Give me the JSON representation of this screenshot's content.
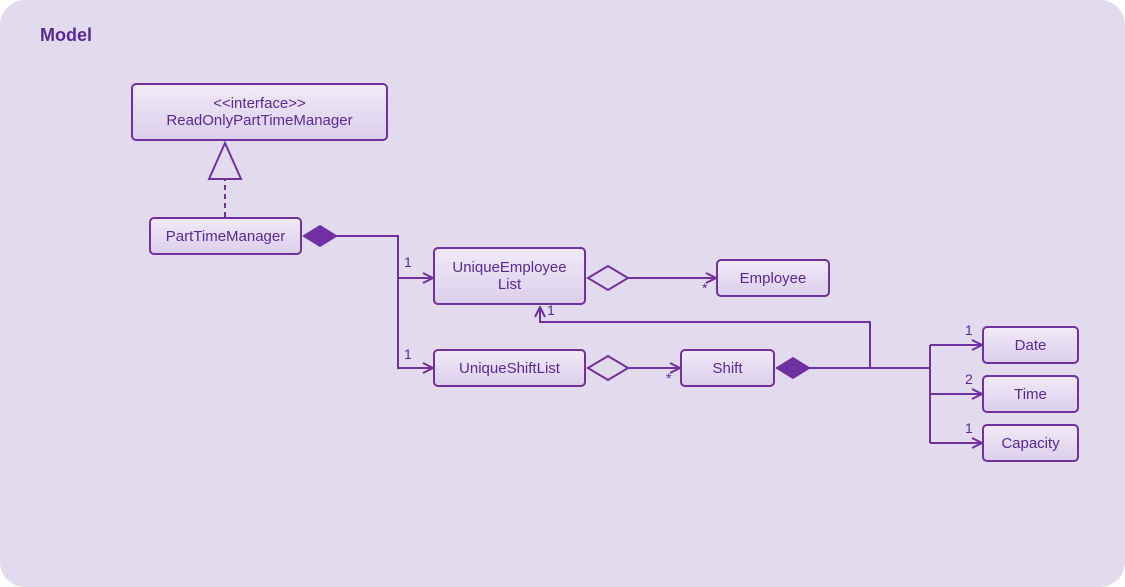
{
  "diagram": {
    "title": "Model",
    "interface": {
      "stereotype": "<<interface>>",
      "name": "ReadOnlyPartTimeManager"
    },
    "partTimeManager": "PartTimeManager",
    "uniqueEmployeeList": {
      "line1": "UniqueEmployee",
      "line2": "List"
    },
    "employee": "Employee",
    "uniqueShiftList": "UniqueShiftList",
    "shift": "Shift",
    "date": "Date",
    "time": "Time",
    "capacity": "Capacity",
    "mult": {
      "ptmToUel": "1",
      "ptmToUsl": "1",
      "uelToEmp": "*",
      "uslToShift": "*",
      "shiftToUel": "1",
      "shiftToDate": "1",
      "shiftToTime": "2",
      "shiftToCapacity": "1"
    }
  }
}
